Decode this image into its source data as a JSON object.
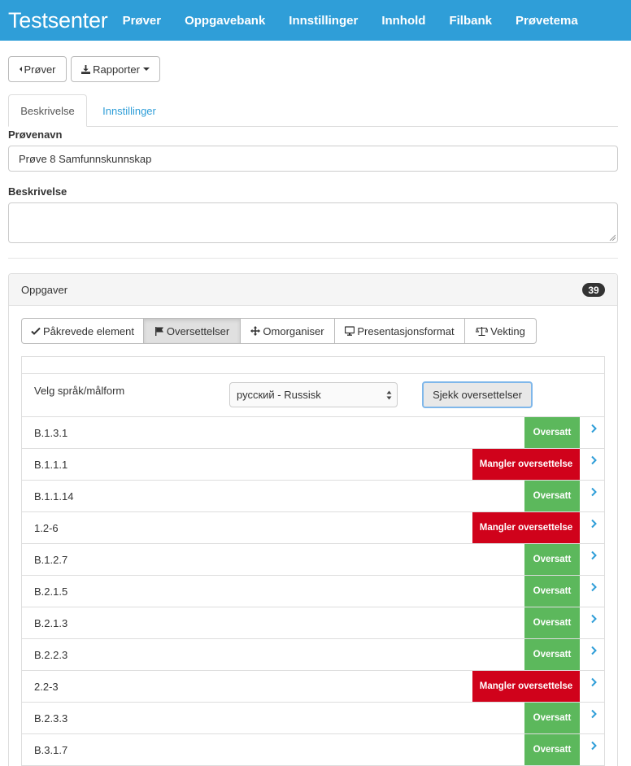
{
  "navbar": {
    "brand": "Testsenter",
    "links": [
      "Prøver",
      "Oppgavebank",
      "Innstillinger",
      "Innhold",
      "Filbank",
      "Prøvetema"
    ]
  },
  "toolbar": {
    "back_label": "Prøver",
    "reports_label": "Rapporter"
  },
  "tabs": [
    "Beskrivelse",
    "Innstillinger"
  ],
  "form": {
    "name_label": "Prøvenavn",
    "name_value": "Prøve 8 Samfunnskunnskap",
    "desc_label": "Beskrivelse",
    "desc_value": ""
  },
  "panel": {
    "title": "Oppgaver",
    "count": "39",
    "modes": [
      "Påkrevede element",
      "Oversettelser",
      "Omorganiser",
      "Presentasjonsformat",
      "Vekting"
    ],
    "language_label": "Velg språk/målform",
    "language_value": "русский - Russisk",
    "check_label": "Sjekk oversettelser",
    "rows": [
      {
        "label": "B.1.3.1",
        "status": "Oversatt"
      },
      {
        "label": "B.1.1.1",
        "status": "Mangler oversettelse"
      },
      {
        "label": "B.1.1.14",
        "status": "Oversatt"
      },
      {
        "label": "1.2-6",
        "status": "Mangler oversettelse"
      },
      {
        "label": "B.1.2.7",
        "status": "Oversatt"
      },
      {
        "label": "B.2.1.5",
        "status": "Oversatt"
      },
      {
        "label": "B.2.1.3",
        "status": "Oversatt"
      },
      {
        "label": "B.2.2.3",
        "status": "Oversatt"
      },
      {
        "label": "2.2-3",
        "status": "Mangler oversettelse"
      },
      {
        "label": "B.2.3.3",
        "status": "Oversatt"
      },
      {
        "label": "B.3.1.7",
        "status": "Oversatt"
      }
    ]
  },
  "colors": {
    "primary": "#2f9ed8",
    "success": "#5cb85c",
    "danger": "#d0021b"
  }
}
